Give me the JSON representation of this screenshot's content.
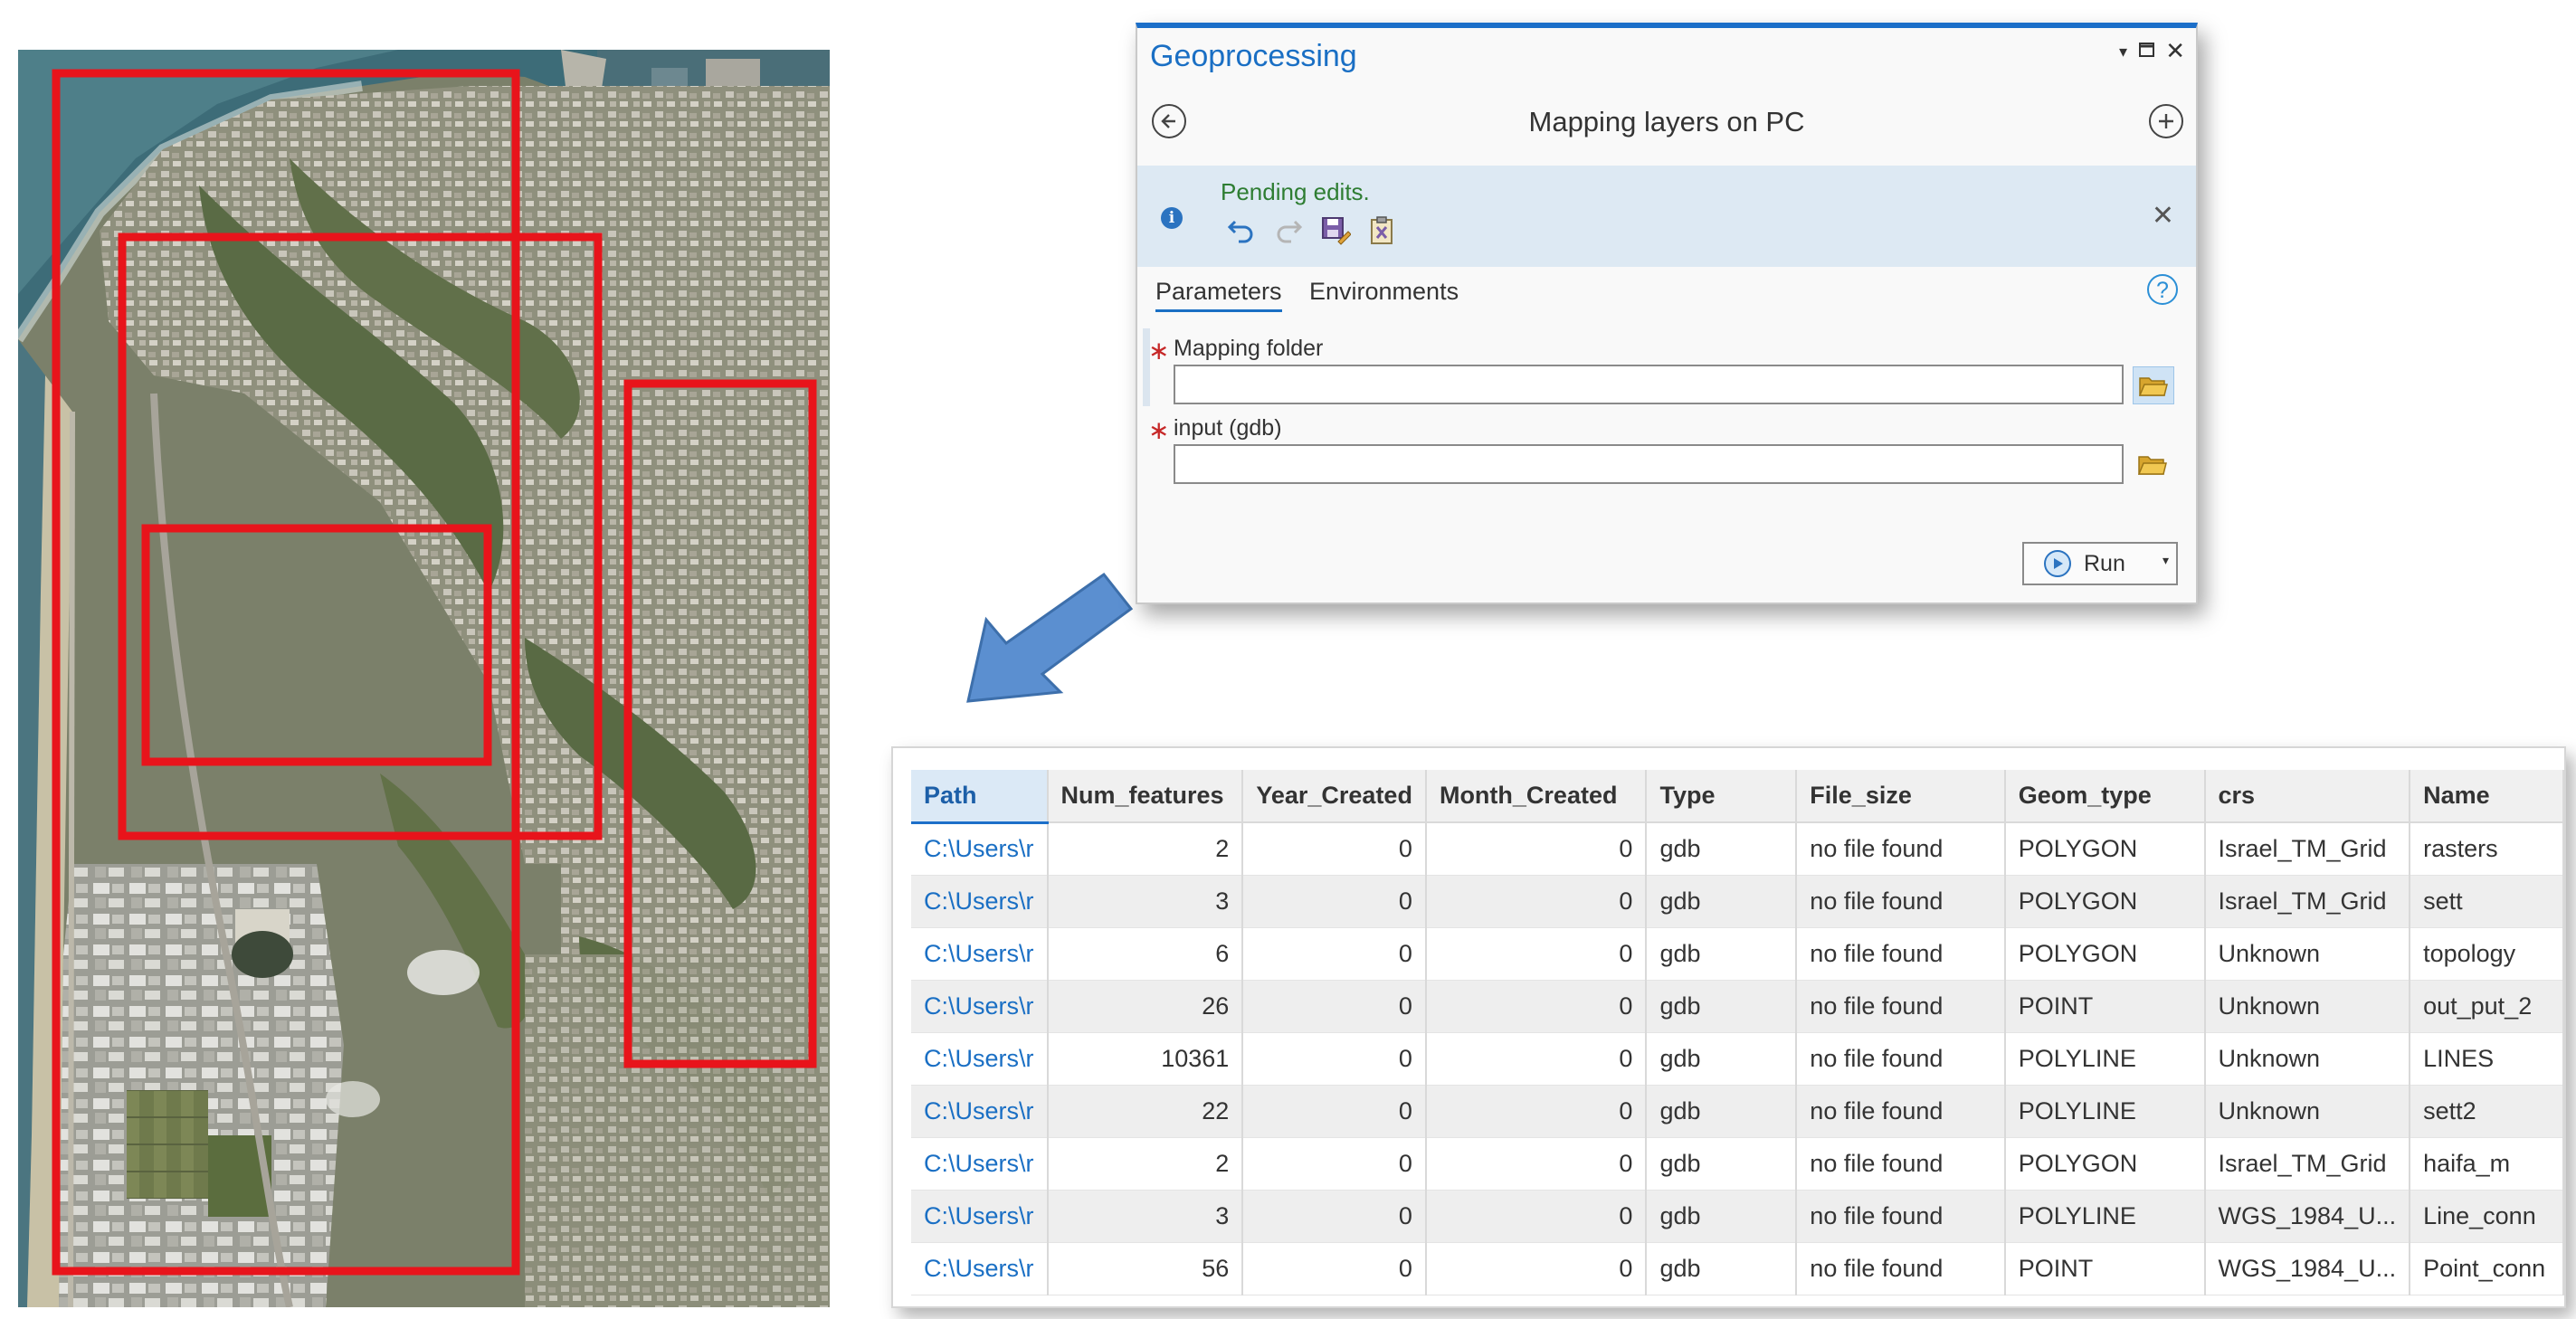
{
  "geoprocessing": {
    "title": "Geoprocessing",
    "tool_title": "Mapping layers on PC",
    "banner_message": "Pending edits.",
    "tabs": [
      "Parameters",
      "Environments"
    ],
    "active_tab": "Parameters",
    "params": [
      {
        "label": "Mapping folder",
        "value": "",
        "required": true
      },
      {
        "label": "input (gdb)",
        "value": "",
        "required": true
      }
    ],
    "run_label": "Run",
    "icons": {
      "back": "back-arrow-icon",
      "add": "add-icon",
      "info": "info-icon",
      "undo": "undo-icon",
      "redo": "redo-icon",
      "save_edits": "save-edits-icon",
      "discard_edits": "discard-edits-icon",
      "close_banner": "close-icon",
      "help": "help-icon",
      "folder": "folder-icon",
      "play": "play-icon"
    },
    "colors": {
      "accent": "#1a6fc4",
      "pending": "#2e7d32",
      "required": "#c62828"
    }
  },
  "table": {
    "columns": [
      "Path",
      "Num_features",
      "Year_Created",
      "Month_Created",
      "Type",
      "File_size",
      "Geom_type",
      "crs",
      "Name"
    ],
    "rows": [
      [
        "C:\\Users\\r",
        "2",
        "0",
        "0",
        "gdb",
        "no file found",
        "POLYGON",
        "Israel_TM_Grid",
        "rasters"
      ],
      [
        "C:\\Users\\r",
        "3",
        "0",
        "0",
        "gdb",
        "no file found",
        "POLYGON",
        "Israel_TM_Grid",
        "sett"
      ],
      [
        "C:\\Users\\r",
        "6",
        "0",
        "0",
        "gdb",
        "no file found",
        "POLYGON",
        "Unknown",
        "topology"
      ],
      [
        "C:\\Users\\r",
        "26",
        "0",
        "0",
        "gdb",
        "no file found",
        "POINT",
        "Unknown",
        "out_put_2"
      ],
      [
        "C:\\Users\\r",
        "10361",
        "0",
        "0",
        "gdb",
        "no file found",
        "POLYLINE",
        "Unknown",
        "LINES"
      ],
      [
        "C:\\Users\\r",
        "22",
        "0",
        "0",
        "gdb",
        "no file found",
        "POLYLINE",
        "Unknown",
        "sett2"
      ],
      [
        "C:\\Users\\r",
        "2",
        "0",
        "0",
        "gdb",
        "no file found",
        "POLYGON",
        "Israel_TM_Grid",
        "haifa_m"
      ],
      [
        "C:\\Users\\r",
        "3",
        "0",
        "0",
        "gdb",
        "no file found",
        "POLYLINE",
        "WGS_1984_U...",
        "Line_conn"
      ],
      [
        "C:\\Users\\r",
        "56",
        "0",
        "0",
        "gdb",
        "no file found",
        "POINT",
        "WGS_1984_U...",
        "Point_conn"
      ]
    ]
  },
  "map": {
    "frame_color": "#e8141b",
    "arrow_color": "#5b8fd0"
  }
}
